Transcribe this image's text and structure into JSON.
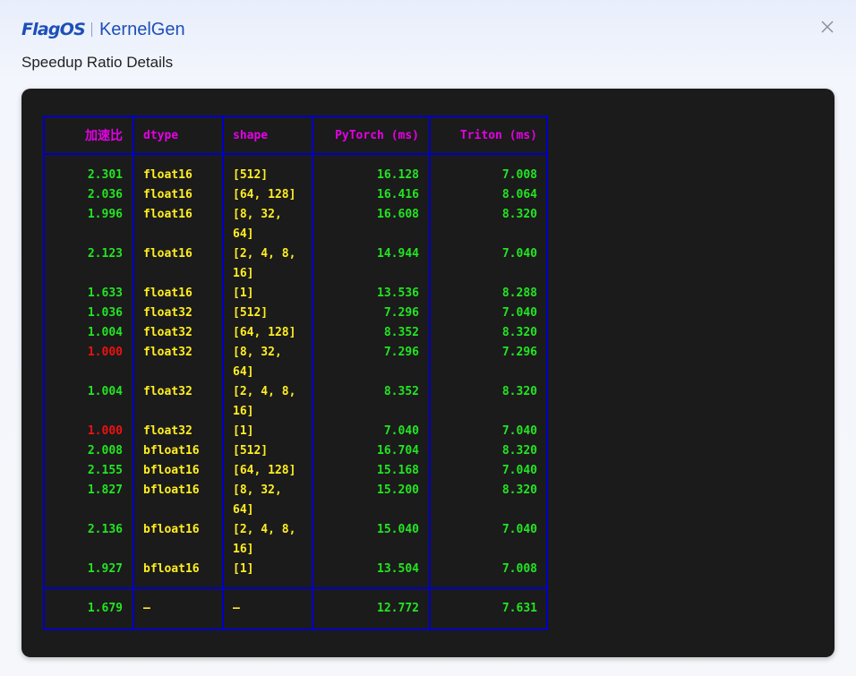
{
  "header": {
    "brand_logo": "FlagOS",
    "brand_product": "KernelGen",
    "close_icon": "close-icon"
  },
  "title": "Speedup Ratio Details",
  "colors": {
    "border": "#0000c8",
    "header_text": "#e500e5",
    "speedup_good": "#22e522",
    "speedup_bad": "#ee1111",
    "dtype_shape": "#ffee22",
    "times": "#22e522"
  },
  "table": {
    "columns": [
      "加速比",
      "dtype",
      "shape",
      "PyTorch (ms)",
      "Triton (ms)"
    ],
    "rows": [
      {
        "speedup": "2.301",
        "dtype": "float16",
        "shape": [
          "[512]"
        ],
        "pytorch": "16.128",
        "triton": "7.008",
        "status": "good"
      },
      {
        "speedup": "2.036",
        "dtype": "float16",
        "shape": [
          "[64, 128]"
        ],
        "pytorch": "16.416",
        "triton": "8.064",
        "status": "good"
      },
      {
        "speedup": "1.996",
        "dtype": "float16",
        "shape": [
          "[8, 32,",
          "64]"
        ],
        "pytorch": "16.608",
        "triton": "8.320",
        "status": "good"
      },
      {
        "speedup": "2.123",
        "dtype": "float16",
        "shape": [
          "[2, 4, 8,",
          "16]"
        ],
        "pytorch": "14.944",
        "triton": "7.040",
        "status": "good"
      },
      {
        "speedup": "1.633",
        "dtype": "float16",
        "shape": [
          "[1]"
        ],
        "pytorch": "13.536",
        "triton": "8.288",
        "status": "good"
      },
      {
        "speedup": "1.036",
        "dtype": "float32",
        "shape": [
          "[512]"
        ],
        "pytorch": "7.296",
        "triton": "7.040",
        "status": "good"
      },
      {
        "speedup": "1.004",
        "dtype": "float32",
        "shape": [
          "[64, 128]"
        ],
        "pytorch": "8.352",
        "triton": "8.320",
        "status": "good"
      },
      {
        "speedup": "1.000",
        "dtype": "float32",
        "shape": [
          "[8, 32,",
          "64]"
        ],
        "pytorch": "7.296",
        "triton": "7.296",
        "status": "bad"
      },
      {
        "speedup": "1.004",
        "dtype": "float32",
        "shape": [
          "[2, 4, 8,",
          "16]"
        ],
        "pytorch": "8.352",
        "triton": "8.320",
        "status": "good"
      },
      {
        "speedup": "1.000",
        "dtype": "float32",
        "shape": [
          "[1]"
        ],
        "pytorch": "7.040",
        "triton": "7.040",
        "status": "bad"
      },
      {
        "speedup": "2.008",
        "dtype": "bfloat16",
        "shape": [
          "[512]"
        ],
        "pytorch": "16.704",
        "triton": "8.320",
        "status": "good"
      },
      {
        "speedup": "2.155",
        "dtype": "bfloat16",
        "shape": [
          "[64, 128]"
        ],
        "pytorch": "15.168",
        "triton": "7.040",
        "status": "good"
      },
      {
        "speedup": "1.827",
        "dtype": "bfloat16",
        "shape": [
          "[8, 32,",
          "64]"
        ],
        "pytorch": "15.200",
        "triton": "8.320",
        "status": "good"
      },
      {
        "speedup": "2.136",
        "dtype": "bfloat16",
        "shape": [
          "[2, 4, 8,",
          "16]"
        ],
        "pytorch": "15.040",
        "triton": "7.040",
        "status": "good"
      },
      {
        "speedup": "1.927",
        "dtype": "bfloat16",
        "shape": [
          "[1]"
        ],
        "pytorch": "13.504",
        "triton": "7.008",
        "status": "good"
      }
    ],
    "summary": {
      "speedup": "1.679",
      "dtype": "—",
      "shape": "—",
      "pytorch": "12.772",
      "triton": "7.631"
    }
  }
}
